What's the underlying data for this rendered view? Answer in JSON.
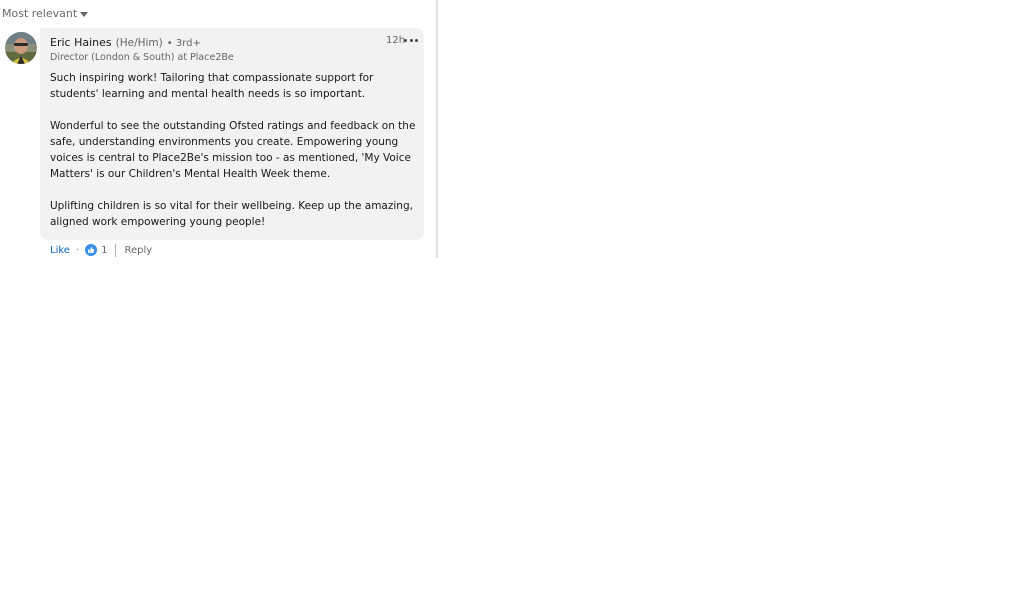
{
  "sort": {
    "label": "Most relevant",
    "icon": "caret-down-icon"
  },
  "comment": {
    "author": {
      "name": "Eric Haines",
      "pronouns": "(He/Him)",
      "degree": "• 3rd+",
      "headline": "Director (London & South) at Place2Be",
      "avatar_icon": "profile-photo"
    },
    "time": "12h",
    "more_icon": "ellipsis-icon",
    "paragraphs": [
      "Such inspiring work! Tailoring that compassionate support for students' learning and mental health needs is so important.",
      "Wonderful to see the outstanding Ofsted ratings and feedback on the safe, understanding environments you create. Empowering young voices is central to Place2Be's mission too - as mentioned, 'My Voice Matters' is our Children's Mental Health Week theme.",
      "Uplifting children is so vital for their wellbeing. Keep up the amazing, aligned work empowering young people!"
    ],
    "actions": {
      "like": "Like",
      "separator": "·",
      "reaction_icon": "thumbs-up-icon",
      "reaction_count": "1",
      "reply": "Reply"
    }
  },
  "colors": {
    "link_blue": "#0a66c2",
    "bubble_bg": "#f2f2f2",
    "like_badge": "#378fe9"
  }
}
